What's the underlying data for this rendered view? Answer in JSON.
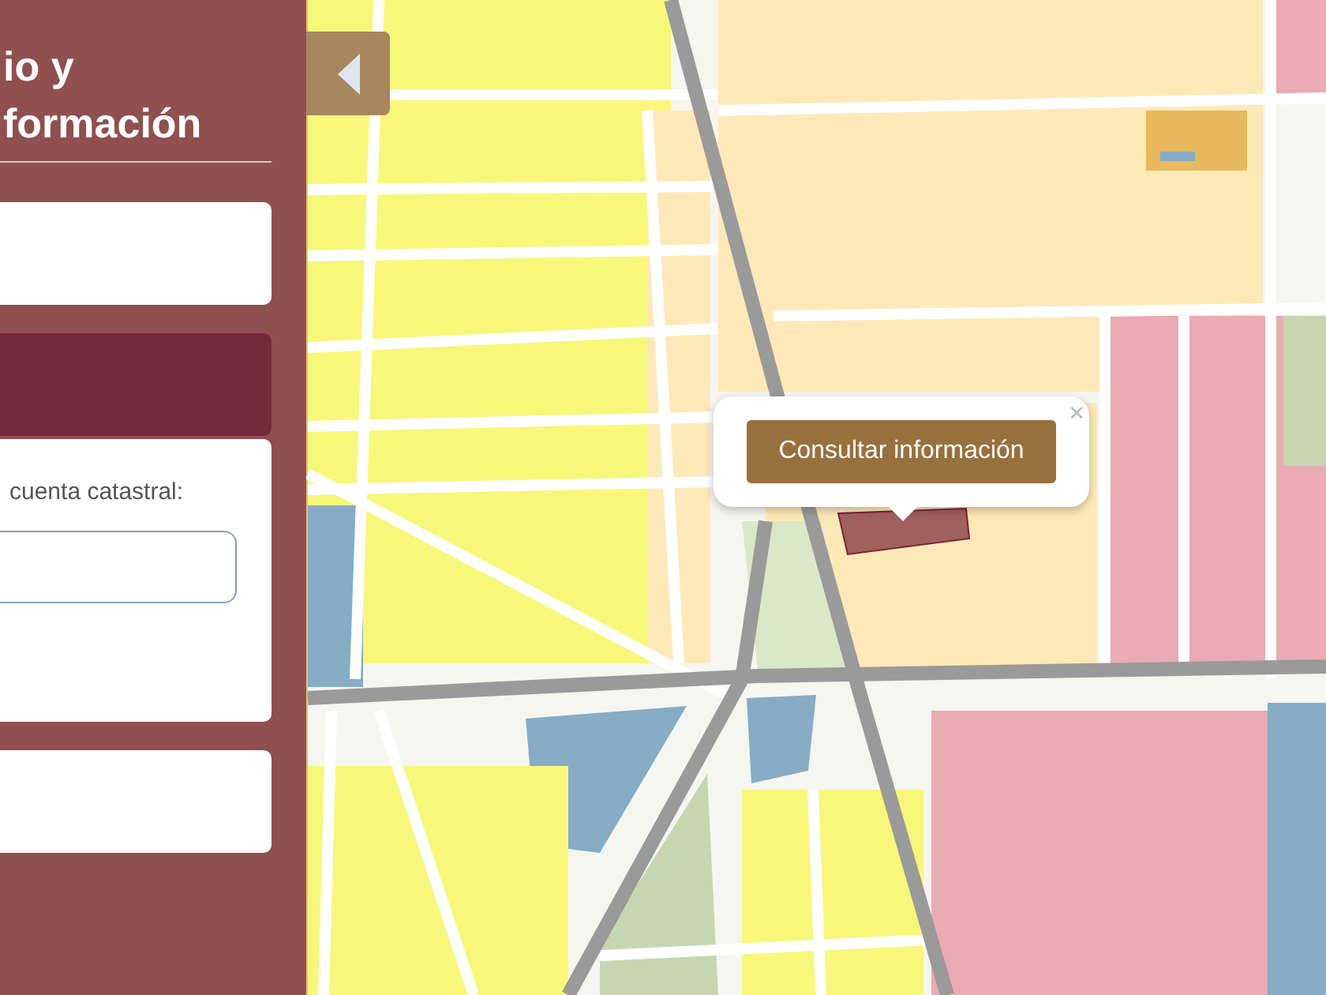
{
  "side_panel": {
    "title_lines": [
      "io y",
      "formación"
    ],
    "cards": [
      {
        "kind": "blank"
      },
      {
        "kind": "accent"
      },
      {
        "kind": "form",
        "label": "cuenta catastral:"
      },
      {
        "kind": "blank"
      }
    ]
  },
  "popup": {
    "button": "Consultar información",
    "close": "×"
  }
}
